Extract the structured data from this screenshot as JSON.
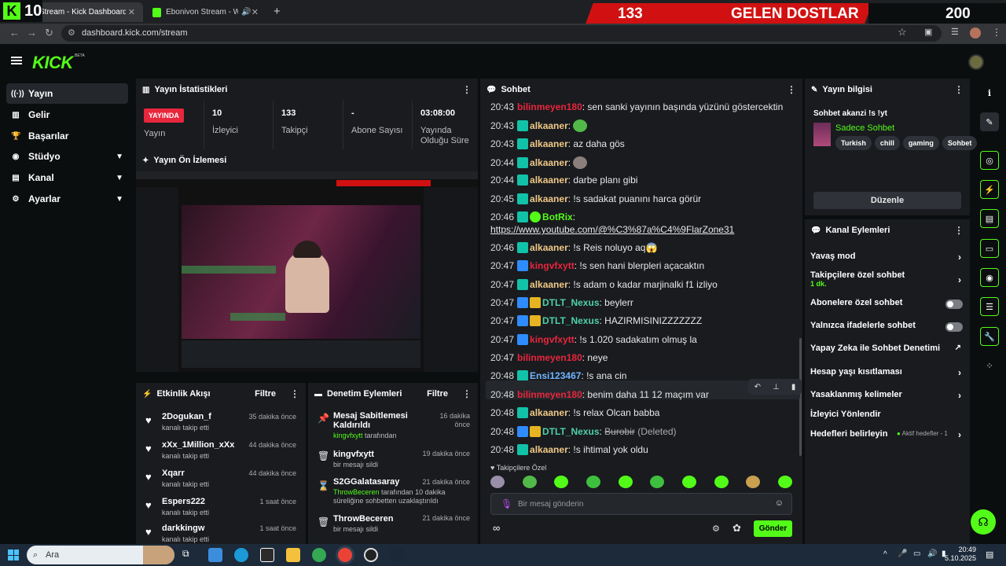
{
  "overlay": {
    "left_count": "10",
    "banner_count": "133",
    "banner_text": "GELEN DOSTLAR",
    "right_count": "200"
  },
  "browser": {
    "tabs": [
      {
        "title": "Stream - Kick Dashboard"
      },
      {
        "title": "Ebonivon Stream - Watch L..."
      }
    ],
    "url": "dashboard.kick.com/stream"
  },
  "header": {
    "logo": "KICK",
    "beta": "BETA"
  },
  "sidebar": {
    "items": [
      {
        "label": "Yayın",
        "icon": "broadcast-icon"
      },
      {
        "label": "Gelir",
        "icon": "chart-icon"
      },
      {
        "label": "Başarılar",
        "icon": "trophy-icon"
      },
      {
        "label": "Stüdyo",
        "icon": "studio-icon"
      },
      {
        "label": "Kanal",
        "icon": "channel-icon"
      },
      {
        "label": "Ayarlar",
        "icon": "gear-icon"
      }
    ]
  },
  "stats": {
    "title": "Yayın İstatistikleri",
    "live_badge": "YAYINDA",
    "live_label": "Yayın",
    "viewers_value": "10",
    "viewers_label": "İzleyici",
    "followers_value": "133",
    "followers_label": "Takipçi",
    "subs_value": "-",
    "subs_label": "Abone Sayısı",
    "duration_value": "03:08:00",
    "duration_label": "Yayında Olduğu Süre"
  },
  "preview": {
    "title": "Yayın Ön İzlemesi"
  },
  "activity": {
    "title": "Etkinlik Akışı",
    "filter": "Filtre",
    "items": [
      {
        "name": "2Dogukan_f",
        "sub": "kanalı takip etti",
        "time": "35 dakika önce"
      },
      {
        "name": "xXx_1Million_xXx",
        "sub": "kanalı takip etti",
        "time": "44 dakika önce"
      },
      {
        "name": "Xqarr",
        "sub": "kanalı takip etti",
        "time": "44 dakika önce"
      },
      {
        "name": "Espers222",
        "sub": "kanalı takip etti",
        "time": "1 saat önce"
      },
      {
        "name": "darkkingw",
        "sub": "kanalı takip etti",
        "time": "1 saat önce"
      }
    ]
  },
  "moderation": {
    "title": "Denetim Eylemleri",
    "filter": "Filtre",
    "items": [
      {
        "title": "Mesaj Sabitlemesi Kaldırıldı",
        "actor": "kingvfxytt",
        "rest": " tarafından",
        "time": "16 dakika önce"
      },
      {
        "title": "kingvfxytt",
        "actor": "",
        "rest": "bir mesajı sildi",
        "time": "19 dakika önce"
      },
      {
        "title": "S2GGalatasaray",
        "actor": "ThrowBeceren",
        "rest": " tarafından 10 dakika süreliğine sohbetten uzaklaştırıldı",
        "time": "21 dakika önce"
      },
      {
        "title": "ThrowBeceren",
        "actor": "",
        "rest": "bir mesajı sildi",
        "time": "21 dakika önce"
      }
    ]
  },
  "chat": {
    "title": "Sohbet",
    "messages": [
      {
        "time": "20:43",
        "user": "bilinmeyen180",
        "color": "#e8263c",
        "text": "sen sanki yayının başında yüzünü göstercektin"
      },
      {
        "time": "20:43",
        "user": "alkaaner",
        "color": "#f0c987",
        "text": ""
      },
      {
        "time": "20:43",
        "user": "alkaaner",
        "color": "#f0c987",
        "text": "az daha gös"
      },
      {
        "time": "20:44",
        "user": "alkaaner",
        "color": "#f0c987",
        "text": ""
      },
      {
        "time": "20:44",
        "user": "alkaaner",
        "color": "#f0c987",
        "text": "darbe planı gibi"
      },
      {
        "time": "20:45",
        "user": "alkaaner",
        "color": "#f0c987",
        "text": "!s sadakat puanını harca görür"
      },
      {
        "time": "20:46",
        "user": "BotRix",
        "color": "#53fc18",
        "text": ""
      },
      {
        "time": "",
        "user": "",
        "color": "#fff",
        "text": "https://www.youtube.com/@%C3%87a%C4%9FlarZone31"
      },
      {
        "time": "20:46",
        "user": "alkaaner",
        "color": "#f0c987",
        "text": "!s Reis noluyo aq😱"
      },
      {
        "time": "20:47",
        "user": "kingvfxytt",
        "color": "#e8263c",
        "text": "!s sen hani blerpleri açacaktın"
      },
      {
        "time": "20:47",
        "user": "alkaaner",
        "color": "#f0c987",
        "text": "!s adam o kadar marjinalki f1 izliyo"
      },
      {
        "time": "20:47",
        "user": "DTLT_Nexus",
        "color": "#4fd1a5",
        "text": "beylerr"
      },
      {
        "time": "20:47",
        "user": "DTLT_Nexus",
        "color": "#4fd1a5",
        "text": "HAZIRMISINIZZZZZZZ"
      },
      {
        "time": "20:47",
        "user": "kingvfxytt",
        "color": "#e8263c",
        "text": "!s 1.020 sadakatım olmuş la"
      },
      {
        "time": "20:47",
        "user": "bilinmeyen180",
        "color": "#e8263c",
        "text": "neye"
      },
      {
        "time": "20:48",
        "user": "Ensi123467",
        "color": "#6fb6ff",
        "text": "!s ana cin"
      },
      {
        "time": "20:48",
        "user": "bilinmeyen180",
        "color": "#e8263c",
        "text": "benim daha 11 12 maçım var"
      },
      {
        "time": "20:48",
        "user": "alkaaner",
        "color": "#f0c987",
        "text": "!s relax Olcan babba"
      },
      {
        "time": "20:48",
        "user": "DTLT_Nexus",
        "color": "#4fd1a5",
        "text": "Burobir",
        "deleted": "(Deleted)"
      },
      {
        "time": "20:48",
        "user": "alkaaner",
        "color": "#f0c987",
        "text": "!s ihtimal yok oldu"
      }
    ],
    "follower_only": "Takipçilere Özel",
    "input_placeholder": "Bir mesaj gönderin",
    "send_label": "Gönder"
  },
  "stream_info": {
    "title": "Yayın bilgisi",
    "stream_title": "Sohbet akanzi !s !yt",
    "category": "Sadece Sohbet",
    "tags": [
      "Turkish",
      "chill",
      "gaming",
      "Sohbet"
    ],
    "edit_label": "Düzenle"
  },
  "channel_actions": {
    "title": "Kanal Eylemleri",
    "slow_mode": "Yavaş mod",
    "followers_only": "Takipçilere özel sohbet",
    "followers_only_sub": "1 dk.",
    "subs_only": "Abonelere özel sohbet",
    "emotes_only": "Yalnızca ifadelerle sohbet",
    "ai_moderation": "Yapay Zeka ile Sohbet Denetimi",
    "age_restrictions": "Hesap yaşı kısıtlaması",
    "banned_words": "Yasaklanmış kelimeler",
    "raid": "İzleyici Yönlendir",
    "goals": "Hedefleri belirleyin",
    "goals_status": "Aktif hedefler - 1"
  },
  "taskbar": {
    "search_placeholder": "Ara",
    "time": "20:49",
    "date": "5.10.2025"
  },
  "colors": {
    "accent": "#53fc18",
    "live": "#e8263c",
    "panel": "#191b1f",
    "background": "#0b0e0f"
  }
}
